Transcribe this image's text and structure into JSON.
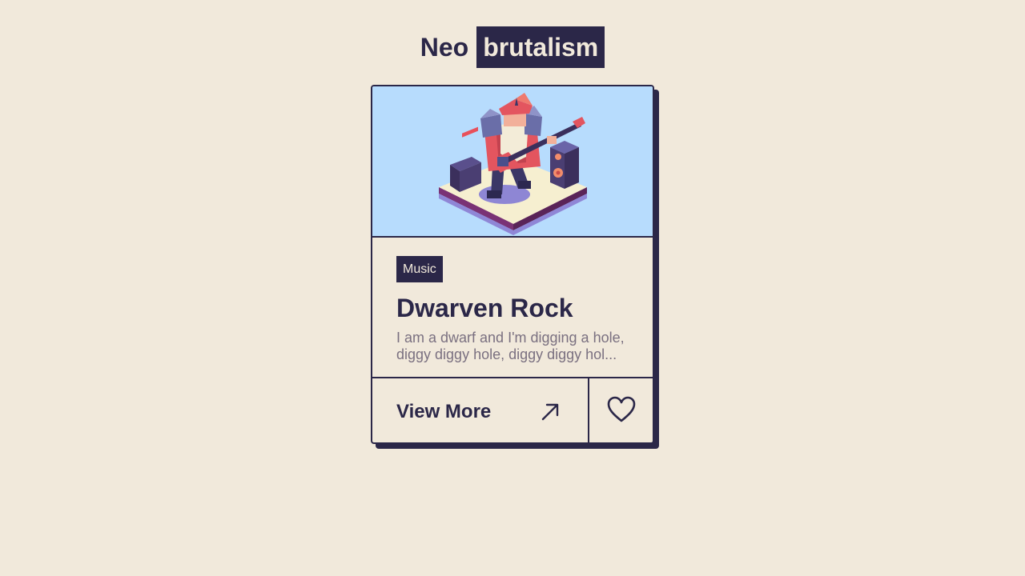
{
  "heading": {
    "plain": "Neo",
    "boxed": "brutalism"
  },
  "card": {
    "image_subject": "isometric dwarf playing electric guitar with amp and speaker",
    "tag": "Music",
    "title": "Dwarven Rock",
    "description": "I am a dwarf and I'm digging a hole, diggy diggy hole, diggy diggy hol...",
    "view_more_label": "View More",
    "view_more_icon": "arrow-up-right-icon",
    "like_icon": "heart-icon"
  },
  "colors": {
    "background": "#f1e9db",
    "ink": "#2b2748",
    "image_background": "#b7dcfd",
    "muted_text": "#7a7080"
  }
}
